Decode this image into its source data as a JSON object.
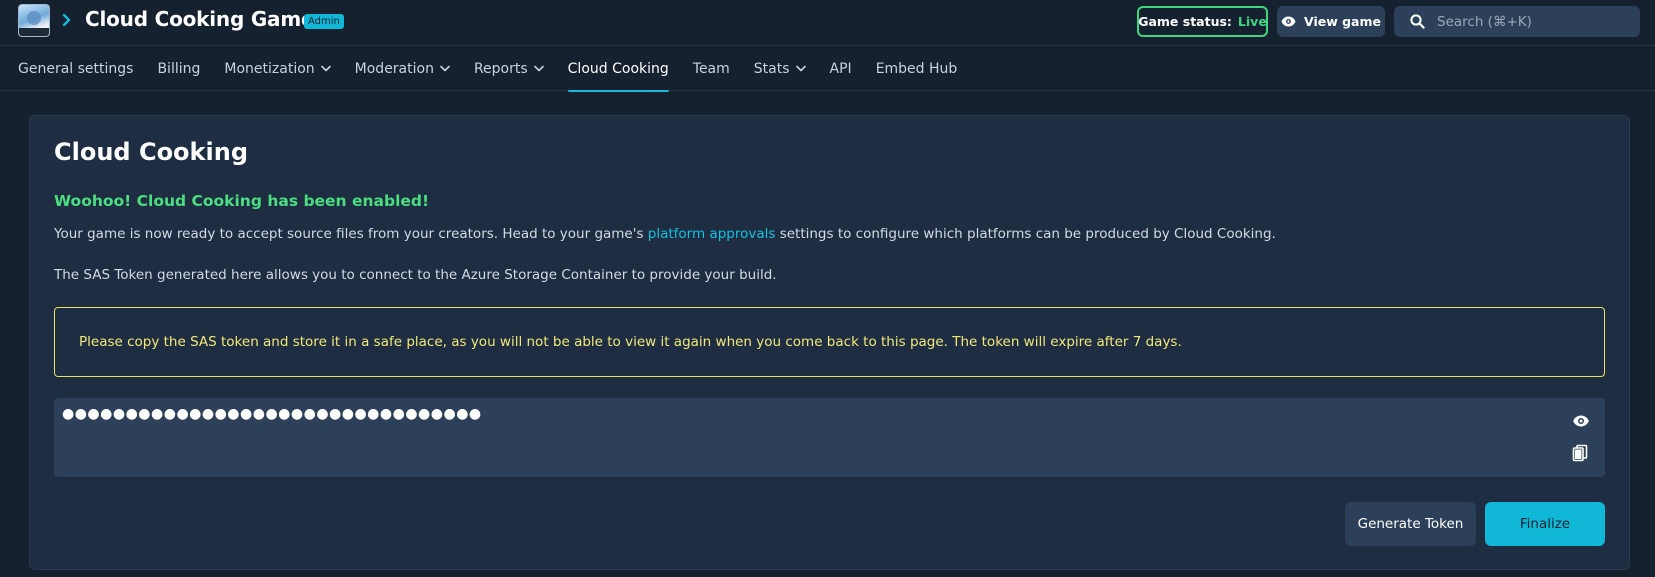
{
  "header": {
    "game_title": "Cloud Cooking Game",
    "badge": "Admin",
    "status_label": "Game status:",
    "status_value": "Live",
    "view_game_label": "View game",
    "search_placeholder": "Search (⌘+K)"
  },
  "nav": {
    "tabs": [
      {
        "label": "General settings",
        "dropdown": false,
        "active": false
      },
      {
        "label": "Billing",
        "dropdown": false,
        "active": false
      },
      {
        "label": "Monetization",
        "dropdown": true,
        "active": false
      },
      {
        "label": "Moderation",
        "dropdown": true,
        "active": false
      },
      {
        "label": "Reports",
        "dropdown": true,
        "active": false
      },
      {
        "label": "Cloud Cooking",
        "dropdown": false,
        "active": true
      },
      {
        "label": "Team",
        "dropdown": false,
        "active": false
      },
      {
        "label": "Stats",
        "dropdown": true,
        "active": false
      },
      {
        "label": "API",
        "dropdown": false,
        "active": false
      },
      {
        "label": "Embed Hub",
        "dropdown": false,
        "active": false
      }
    ]
  },
  "main": {
    "title": "Cloud Cooking",
    "success_message": "Woohoo! Cloud Cooking has been enabled!",
    "paragraph1_before": "Your game is now ready to accept source files from your creators. Head to your game's ",
    "paragraph1_link": "platform approvals",
    "paragraph1_after": " settings to configure which platforms can be produced by Cloud Cooking.",
    "paragraph2": "The SAS Token generated here allows you to connect to the Azure Storage Container to provide your build.",
    "warning": "Please copy the SAS token and store it in a safe place, as you will not be able to view it again when you come back to this page. The token will expire after 7 days.",
    "token_masked": "●●●●●●●●●●●●●●●●●●●●●●●●●●●●●●●●●",
    "generate_label": "Generate Token",
    "finalize_label": "Finalize"
  },
  "colors": {
    "background": "#162130",
    "panel": "#1e2d41",
    "accent": "#11b7d6",
    "success": "#4ade80",
    "warning": "#e7e06a"
  }
}
